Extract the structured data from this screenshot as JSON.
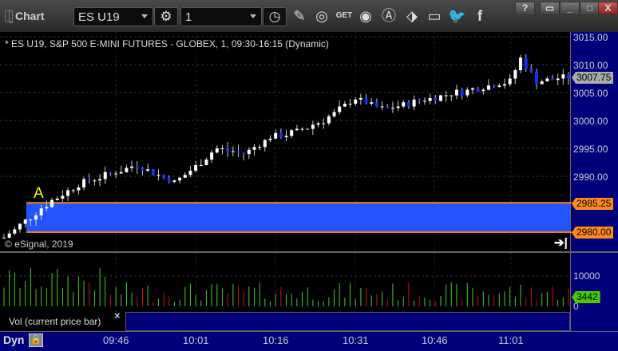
{
  "window": {
    "title": "Chart",
    "help": "?",
    "minimize": "_",
    "maximize": "□",
    "close": "X"
  },
  "toolbar": {
    "symbol": "ES U19",
    "interval": "1",
    "tools": [
      "pencil-icon",
      "study-icon",
      "get-icon",
      "play-icon",
      "alert-icon",
      "link-icon",
      "comment-icon",
      "twitter-icon",
      "facebook-icon"
    ],
    "get_label": "GET"
  },
  "chart": {
    "info": "* ES U19, S&P 500 E-MINI FUTURES - GLOBEX, 1, 09:30-16:15 (Dynamic)",
    "copyright": "© eSignal, 2019",
    "price_labels": [
      "3015.00",
      "3010.00",
      "3005.00",
      "3000.00",
      "2995.00",
      "2990.00"
    ],
    "current_price": "3007.75",
    "zone_high": "2985.25",
    "zone_low": "2980.00",
    "marker": "A",
    "zone_color": "#2255ff",
    "line_color": "#ff8000",
    "volume_labels": [
      "10000",
      "0"
    ],
    "current_volume": "3442",
    "volume_panel_label": "Vol (current price bar)",
    "panel_close": "×",
    "time_labels": [
      "09:46",
      "10:01",
      "10:16",
      "10:31",
      "10:46",
      "11:01"
    ],
    "mode": "Dyn"
  },
  "chart_data": {
    "type": "candlestick",
    "x_range": [
      "09:25",
      "11:11"
    ],
    "ylim": [
      2978,
      3016
    ],
    "close_keypoints": [
      [
        0,
        2979
      ],
      [
        8,
        2985
      ],
      [
        15,
        2989
      ],
      [
        25,
        2992
      ],
      [
        32,
        2989
      ],
      [
        35,
        2991
      ],
      [
        40,
        2995
      ],
      [
        45,
        2994
      ],
      [
        50,
        2997
      ],
      [
        55,
        2998
      ],
      [
        60,
        3000
      ],
      [
        66,
        3004
      ],
      [
        71,
        3002
      ],
      [
        80,
        3004
      ],
      [
        90,
        3006
      ],
      [
        95,
        3007
      ],
      [
        97,
        3011
      ],
      [
        100,
        3007
      ],
      [
        106,
        3007.75
      ]
    ]
  }
}
